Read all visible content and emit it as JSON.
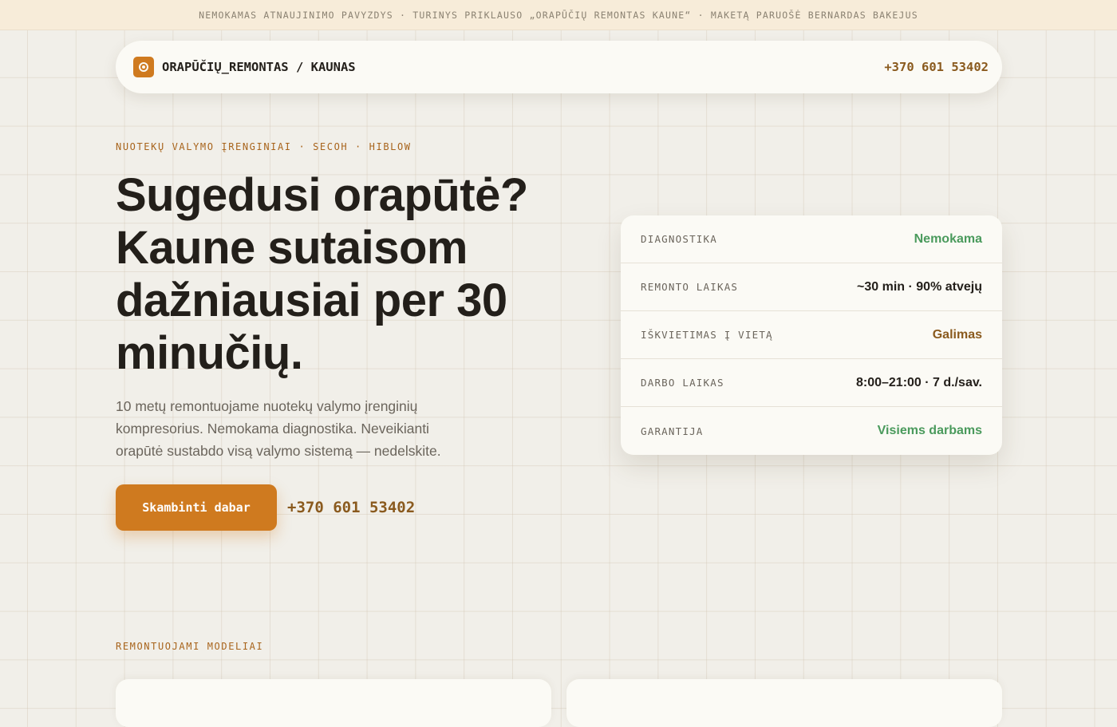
{
  "banner": {
    "text": "NEMOKAMAS ATNAUJINIMO PAVYZDYS · TURINYS PRIKLAUSO „ORAPŪČIŲ REMONTAS KAUNE“ · MAKETĄ PARUOŠĖ BERNARDAS BAKEJUS"
  },
  "nav": {
    "logo_icon": "target-icon",
    "brand": "ORAPŪČIŲ_REMONTAS / KAUNAS",
    "phone": "+370 601 53402"
  },
  "hero": {
    "eyebrow": "NUOTEKŲ VALYMO ĮRENGINIAI · SECOH · HIBLOW",
    "title": "Sugedusi orapūtė? Kaune sutaisom dažniausiai per 30 minučių.",
    "description": "10 metų remontuojame nuotekų valymo įrenginių kompresorius. Nemokama diagnostika. Neveikianti orapūtė sustabdo visą valymo sistemą — nedelskite.",
    "cta_label": "Skambinti dabar",
    "cta_phone": "+370 601 53402"
  },
  "info": {
    "rows": [
      {
        "label": "DIAGNOSTIKA",
        "value": "Nemokama"
      },
      {
        "label": "REMONTO LAIKAS",
        "value": "~30 min · 90% atvejų"
      },
      {
        "label": "IŠKVIETIMAS Į VIETĄ",
        "value": "Galimas"
      },
      {
        "label": "DARBO LAIKAS",
        "value": "8:00–21:00 · 7 d./sav."
      },
      {
        "label": "GARANTIJA",
        "value": "Visiems darbams"
      }
    ]
  },
  "models": {
    "eyebrow": "REMONTUOJAMI MODELIAI"
  },
  "colors": {
    "accent": "#cf7a1f",
    "phone": "#8a5a1e",
    "positive": "#4a9a5c",
    "text": "#231f1a",
    "background": "#f1efe9"
  }
}
